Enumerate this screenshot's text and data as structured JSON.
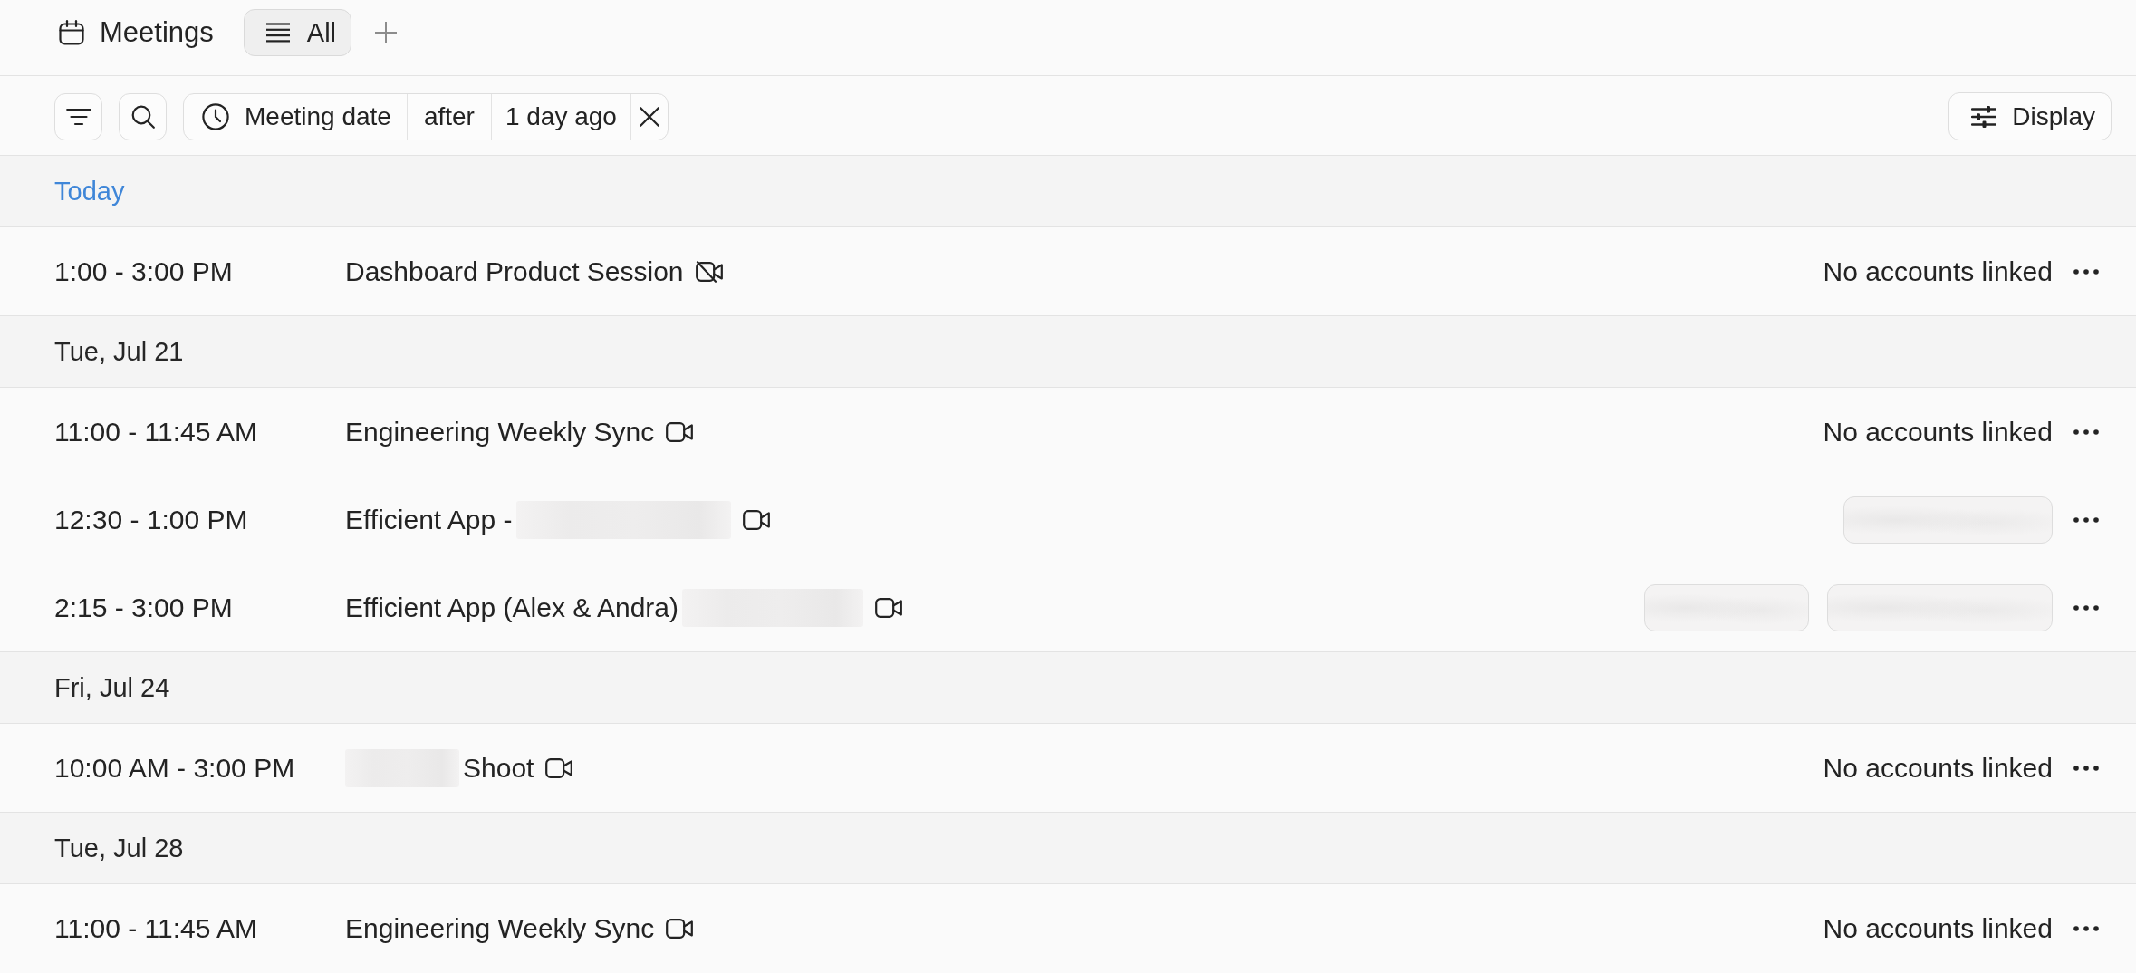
{
  "header": {
    "title": "Meetings",
    "tabs": [
      {
        "label": "All",
        "selected": true
      }
    ]
  },
  "filter_bar": {
    "filters": [
      {
        "field": "Meeting date",
        "operator": "after",
        "value": "1 day ago"
      }
    ],
    "display_button": "Display"
  },
  "groups": [
    {
      "label": "Today",
      "current": true,
      "events": [
        {
          "time": "1:00 - 3:00 PM",
          "title": [
            {
              "kind": "text",
              "text": "Dashboard Product Session"
            }
          ],
          "video": false,
          "accounts_label": "No accounts linked"
        }
      ]
    },
    {
      "label": "Tue, Jul 21",
      "current": false,
      "events": [
        {
          "time": "11:00 - 11:45 AM",
          "title": [
            {
              "kind": "text",
              "text": "Engineering Weekly Sync"
            }
          ],
          "video": true,
          "accounts_label": "No accounts linked"
        },
        {
          "time": "12:30 - 1:00 PM",
          "title": [
            {
              "kind": "text",
              "text": "Efficient App -"
            },
            {
              "kind": "redacted"
            }
          ],
          "video": true,
          "accounts": [
            {
              "kind": "redacted"
            }
          ]
        },
        {
          "time": "2:15 - 3:00 PM",
          "title": [
            {
              "kind": "text",
              "text": "Efficient App (Alex & Andra)"
            },
            {
              "kind": "redacted"
            }
          ],
          "video": true,
          "accounts": [
            {
              "kind": "redacted"
            },
            {
              "kind": "redacted"
            }
          ]
        }
      ]
    },
    {
      "label": "Fri, Jul 24",
      "current": false,
      "events": [
        {
          "time": "10:00 AM - 3:00 PM",
          "title": [
            {
              "kind": "redacted"
            },
            {
              "kind": "text",
              "text": "Shoot"
            }
          ],
          "video": true,
          "accounts_label": "No accounts linked"
        }
      ]
    },
    {
      "label": "Tue, Jul 28",
      "current": false,
      "events": [
        {
          "time": "11:00 - 11:45 AM",
          "title": [
            {
              "kind": "text",
              "text": "Engineering Weekly Sync"
            }
          ],
          "video": true,
          "accounts_label": "No accounts linked"
        }
      ]
    }
  ]
}
